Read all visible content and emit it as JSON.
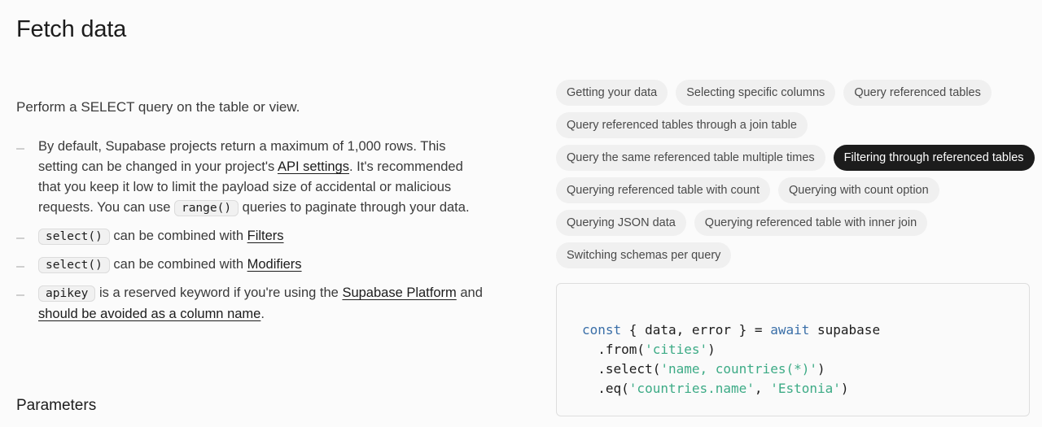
{
  "page": {
    "title": "Fetch data",
    "params_heading": "Parameters"
  },
  "intro": "Perform a SELECT query on the table or view.",
  "notes": [
    {
      "t1": "By default, Supabase projects return a maximum of 1,000 rows. This setting can be changed in your project's ",
      "link": "API settings",
      "t2": ". It's recommended that you keep it low to limit the payload size of accidental or malicious requests. You can use ",
      "code": "range()",
      "t3": " queries to paginate through your data."
    },
    {
      "code": "select()",
      "t1": " can be combined with ",
      "link": "Filters"
    },
    {
      "code": "select()",
      "t1": " can be combined with ",
      "link": "Modifiers"
    },
    {
      "code": "apikey",
      "t1": " is a reserved keyword if you're using the ",
      "link1": "Supabase Platform",
      "t2": " and ",
      "link2": "should be avoided as a column name",
      "t3": "."
    }
  ],
  "chips": [
    "Getting your data",
    "Selecting specific columns",
    "Query referenced tables",
    "Query referenced tables through a join table",
    "Query the same referenced table multiple times",
    "Filtering through referenced tables",
    "Querying referenced table with count",
    "Querying with count option",
    "Querying JSON data",
    "Querying referenced table with inner join",
    "Switching schemas per query"
  ],
  "active_chip": "Filtering through referenced tables",
  "code": {
    "l1": {
      "kw1": "const",
      "t1": " { data, error } = ",
      "kw2": "await",
      "t2": " supabase"
    },
    "l2": {
      "t1": "  .from(",
      "s1": "'cities'",
      "t2": ")"
    },
    "l3": {
      "t1": "  .select(",
      "s1": "'name, countries(*)'",
      "t2": ")"
    },
    "l4": {
      "t1": "  .eq(",
      "s1": "'countries.name'",
      "t2": ", ",
      "s2": "'Estonia'",
      "t3": ")"
    }
  },
  "colors": {
    "keyword": "#3a6fa8",
    "string": "#3dab86",
    "active_chip_bg": "#1c1c1c",
    "chip_bg": "#f0f0f0"
  }
}
